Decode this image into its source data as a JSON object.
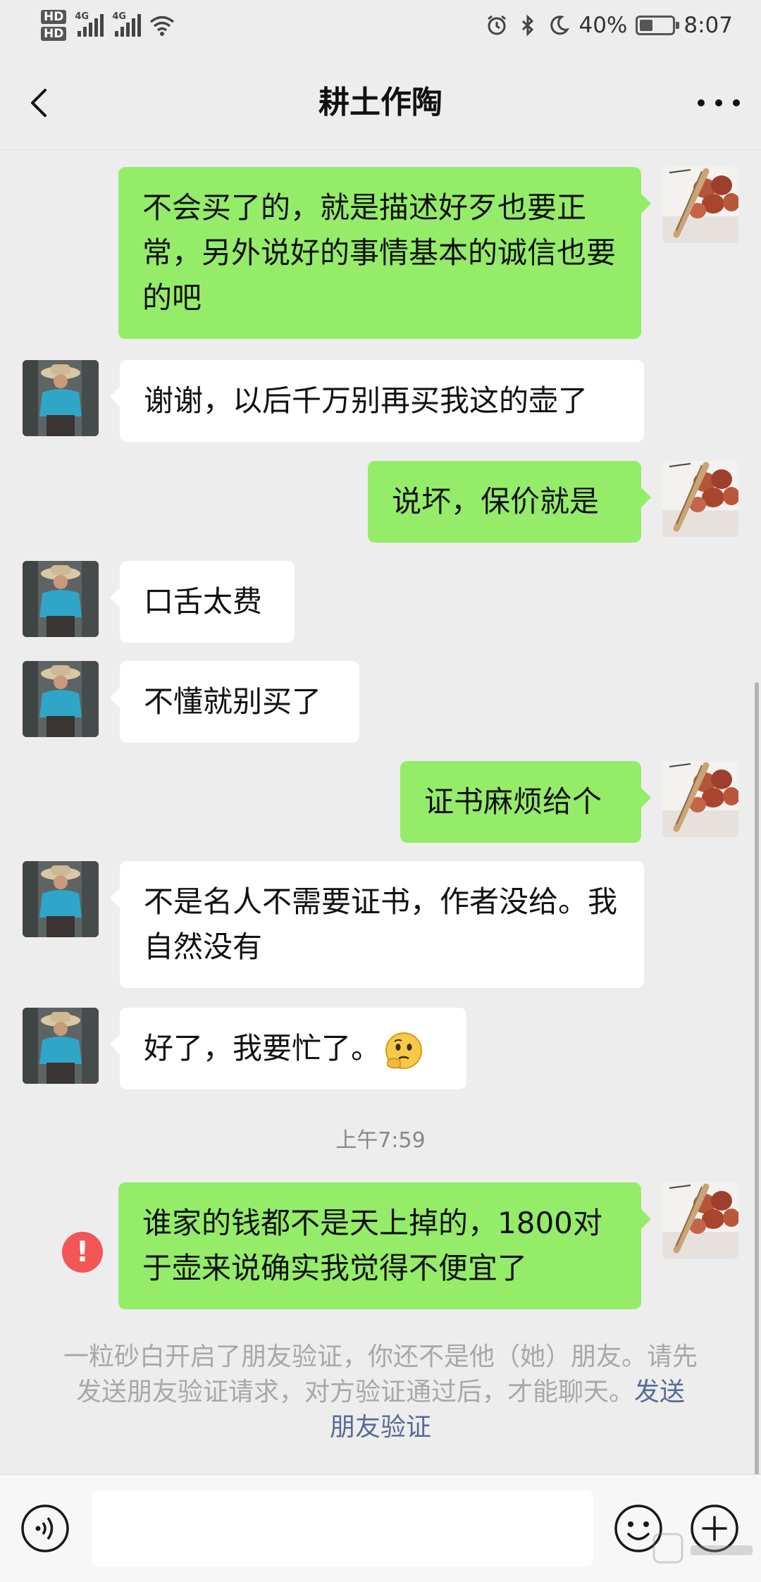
{
  "status_bar": {
    "hd1": "HD",
    "hd2": "HD",
    "net1": "4G",
    "net2": "4G",
    "battery": "40%",
    "battery_level": 0.4,
    "time": "8:07"
  },
  "header": {
    "title": "耕土作陶"
  },
  "messages": [
    {
      "side": "out",
      "text": "不会买了的，就是描述好歹也要正常，另外说好的事情基本的诚信也要的吧"
    },
    {
      "side": "in",
      "text": "谢谢，以后千万别再买我这的壶了"
    },
    {
      "side": "out",
      "text": "说坏，保价就是"
    },
    {
      "side": "in",
      "text": "口舌太费"
    },
    {
      "side": "in",
      "text": "不懂就别买了"
    },
    {
      "side": "out",
      "text": "证书麻烦给个"
    },
    {
      "side": "in",
      "text": "不是名人不需要证书，作者没给。我自然没有"
    },
    {
      "side": "in",
      "text": "好了，我要忙了。"
    },
    {
      "side": "out",
      "text": "谁家的钱都不是天上掉的，1800对于壶来说确实我觉得不便宜了",
      "failed": true
    }
  ],
  "timestamp": "上午7:59",
  "error_mark": "!",
  "system_notice": {
    "text": "一粒砂白开启了朋友验证，你还不是他（她）朋友。请先发送朋友验证请求，对方验证通过后，才能聊天。",
    "link": "发送朋友验证"
  },
  "icons": {
    "back": "back-arrow-icon",
    "more": "more-icon",
    "voice": "voice-icon",
    "emoji": "emoji-icon",
    "plus": "plus-icon"
  },
  "colors": {
    "sent_bubble": "#95ec69",
    "received_bubble": "#ffffff",
    "background": "#ededed",
    "link": "#576b95",
    "error": "#f25755"
  }
}
